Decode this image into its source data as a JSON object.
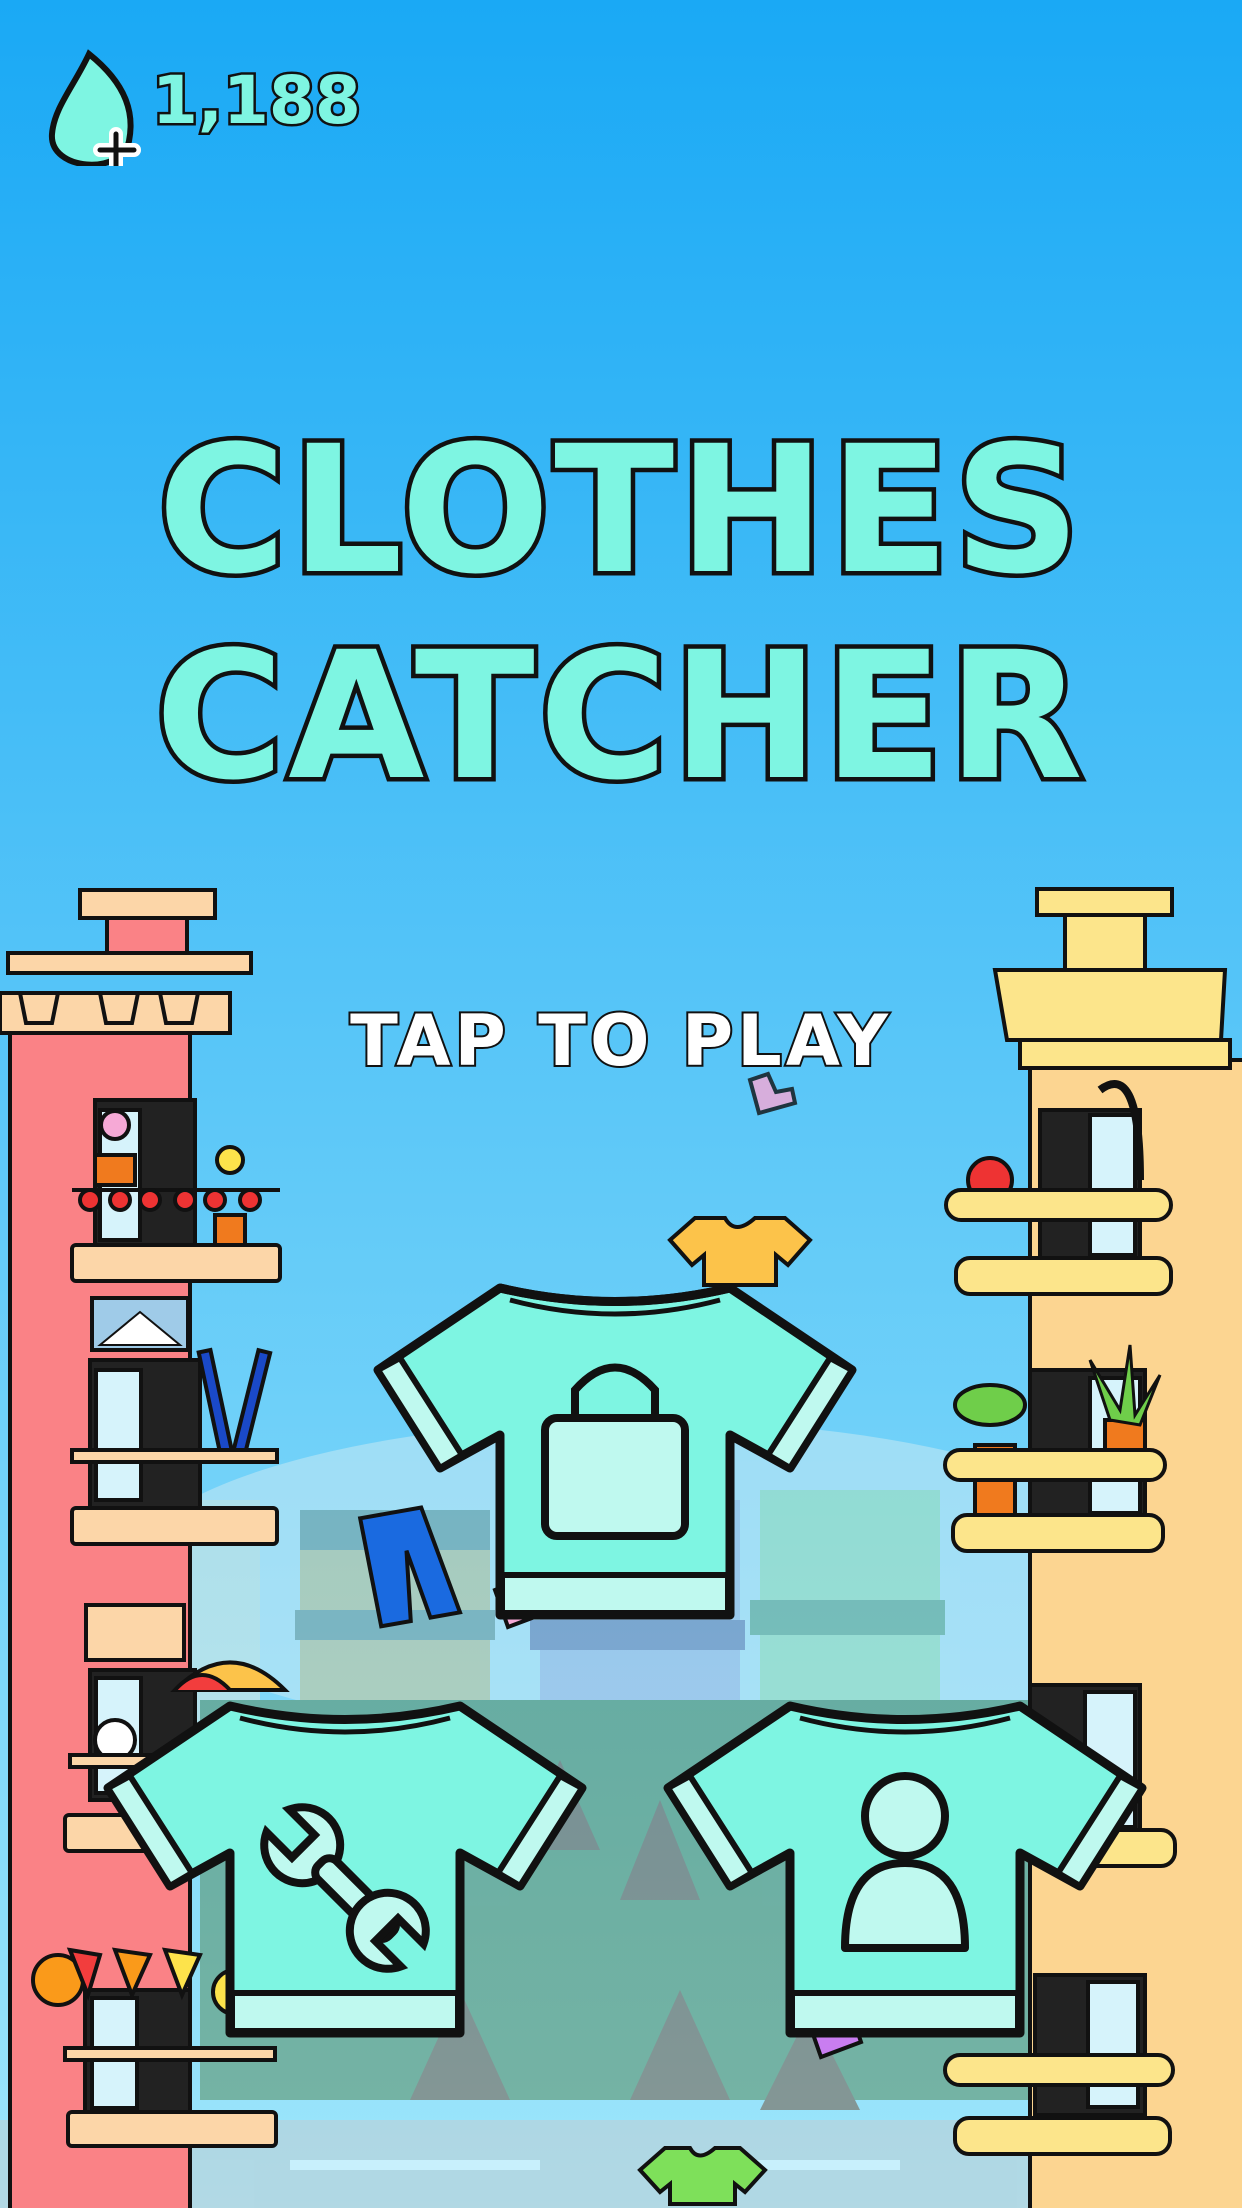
{
  "currency": {
    "amount": "1,188",
    "icon": "droplet-plus-icon"
  },
  "title": {
    "line1": "CLOTHES",
    "line2": "CATCHER"
  },
  "prompt": {
    "tap_to_play": "TAP TO PLAY"
  },
  "menu_buttons": [
    {
      "icon": "bag-icon"
    },
    {
      "icon": "wrench-icon"
    },
    {
      "icon": "person-icon"
    }
  ],
  "colors": {
    "sky_top": "#1aa9f5",
    "sky_bottom": "#9ee6fb",
    "accent": "#7ef5e2",
    "left_building": "#fa8286",
    "right_building": "#fcd591",
    "outline": "#111111"
  }
}
